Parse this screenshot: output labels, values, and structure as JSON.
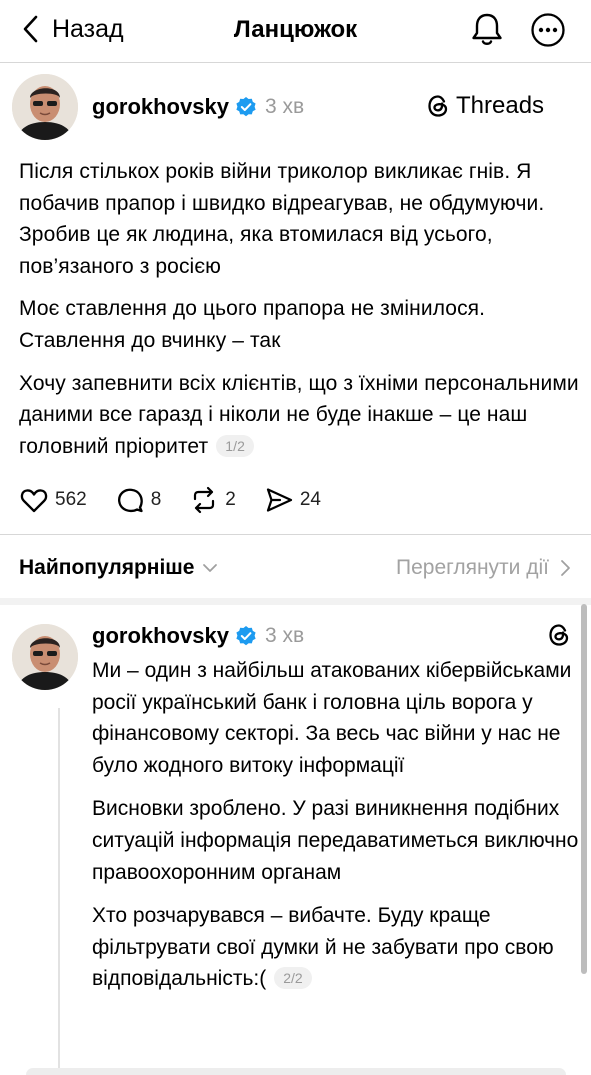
{
  "header": {
    "back_label": "Назад",
    "title": "Ланцюжок",
    "icons": [
      "chevron-left-icon",
      "bell-icon",
      "more-icon"
    ]
  },
  "post": {
    "username": "gorokhovsky",
    "time": "3 хв",
    "badge_label": "Threads",
    "paragraphs": [
      "Після стількох років війни триколор викликає гнів. Я побачив прапор і швидко відреагував, не обдумуючи. Зробив це як людина, яка втомилася від усього, пов’язаного з росією",
      "Моє ставлення до цього прапора не змінилося. Ставлення до вчинку – так",
      "Хочу запевнити всіх клієнтів, що з їхніми персональними даними все гаразд і ніколи не буде інакше – це наш головний пріоритет"
    ],
    "pager": "1/2",
    "likes": "562",
    "comments": "8",
    "reposts": "2",
    "shares": "24"
  },
  "sort": {
    "label": "Найпопулярніше",
    "activity_label": "Переглянути дії"
  },
  "reply": {
    "username": "gorokhovsky",
    "time": "3 хв",
    "paragraphs": [
      "Ми – один з найбільш атакованих кібервійськами росії український банк і головна ціль ворога у фінансовому секторі. За весь час війни у нас не було жодного витоку інформації",
      "Висновки зроблено. У разі виникнення подібних ситуацій інформація передаватиметься виключно правоохоронним органам",
      "Хто розчарувався – вибачте. Буду краще фільтрувати свої думки й не забувати про свою відповідальність:("
    ],
    "pager": "2/2"
  },
  "colors": {
    "verified": "#1d9bf0",
    "muted": "#9a9a9a",
    "divider": "#d7d7d7"
  }
}
